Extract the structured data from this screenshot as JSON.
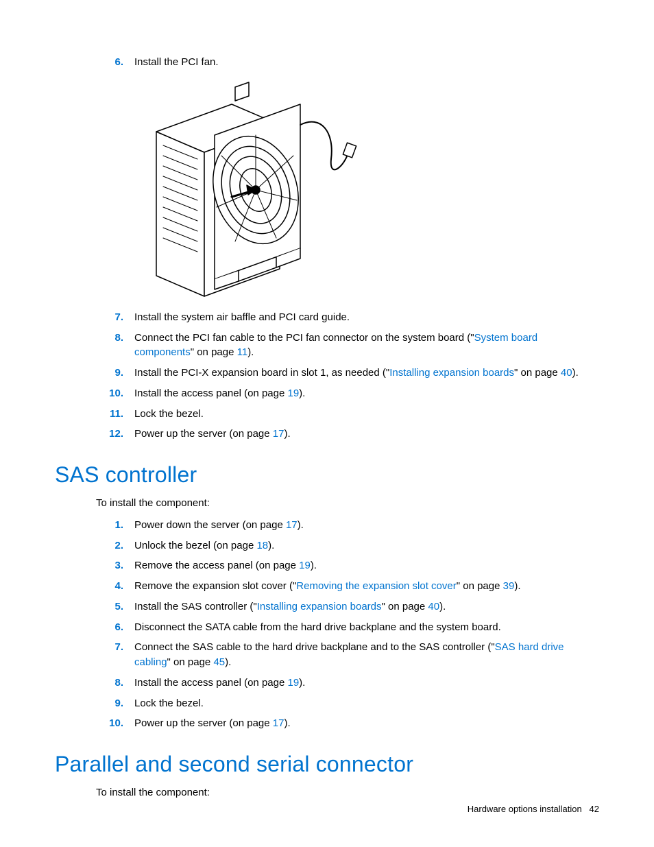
{
  "list1": [
    {
      "n": "6.",
      "segments": [
        {
          "t": "Install the PCI fan."
        }
      ]
    },
    {
      "n": "7.",
      "segments": [
        {
          "t": "Install the system air baffle and PCI card guide."
        }
      ]
    },
    {
      "n": "8.",
      "segments": [
        {
          "t": "Connect the PCI fan cable to the PCI fan connector on the system board (\""
        },
        {
          "t": "System board components",
          "link": true
        },
        {
          "t": "\" on page "
        },
        {
          "t": "11",
          "link": true
        },
        {
          "t": ")."
        }
      ]
    },
    {
      "n": "9.",
      "segments": [
        {
          "t": "Install the PCI-X expansion board in slot 1, as needed (\""
        },
        {
          "t": "Installing expansion boards",
          "link": true
        },
        {
          "t": "\" on page "
        },
        {
          "t": "40",
          "link": true
        },
        {
          "t": ")."
        }
      ]
    },
    {
      "n": "10.",
      "segments": [
        {
          "t": "Install the access panel (on page "
        },
        {
          "t": "19",
          "link": true
        },
        {
          "t": ")."
        }
      ]
    },
    {
      "n": "11.",
      "segments": [
        {
          "t": "Lock the bezel."
        }
      ]
    },
    {
      "n": "12.",
      "segments": [
        {
          "t": "Power up the server (on page "
        },
        {
          "t": "17",
          "link": true
        },
        {
          "t": ")."
        }
      ]
    }
  ],
  "heading1": "SAS controller",
  "intro1": "To install the component:",
  "list2": [
    {
      "n": "1.",
      "segments": [
        {
          "t": "Power down the server (on page "
        },
        {
          "t": "17",
          "link": true
        },
        {
          "t": ")."
        }
      ]
    },
    {
      "n": "2.",
      "segments": [
        {
          "t": "Unlock the bezel (on page "
        },
        {
          "t": "18",
          "link": true
        },
        {
          "t": ")."
        }
      ]
    },
    {
      "n": "3.",
      "segments": [
        {
          "t": "Remove the access panel (on page "
        },
        {
          "t": "19",
          "link": true
        },
        {
          "t": ")."
        }
      ]
    },
    {
      "n": "4.",
      "segments": [
        {
          "t": "Remove the expansion slot cover (\""
        },
        {
          "t": "Removing the expansion slot cover",
          "link": true
        },
        {
          "t": "\" on page "
        },
        {
          "t": "39",
          "link": true
        },
        {
          "t": ")."
        }
      ]
    },
    {
      "n": "5.",
      "segments": [
        {
          "t": "Install the SAS controller (\""
        },
        {
          "t": "Installing expansion boards",
          "link": true
        },
        {
          "t": "\" on page "
        },
        {
          "t": "40",
          "link": true
        },
        {
          "t": ")."
        }
      ]
    },
    {
      "n": "6.",
      "segments": [
        {
          "t": "Disconnect the SATA cable from the hard drive backplane and the system board."
        }
      ]
    },
    {
      "n": "7.",
      "segments": [
        {
          "t": "Connect the SAS cable to the hard drive backplane and to the SAS controller (\""
        },
        {
          "t": "SAS hard drive cabling",
          "link": true
        },
        {
          "t": "\" on page "
        },
        {
          "t": "45",
          "link": true
        },
        {
          "t": ")."
        }
      ]
    },
    {
      "n": "8.",
      "segments": [
        {
          "t": "Install the access panel (on page "
        },
        {
          "t": "19",
          "link": true
        },
        {
          "t": ")."
        }
      ]
    },
    {
      "n": "9.",
      "segments": [
        {
          "t": "Lock the bezel."
        }
      ]
    },
    {
      "n": "10.",
      "segments": [
        {
          "t": "Power up the server (on page "
        },
        {
          "t": "17",
          "link": true
        },
        {
          "t": ")."
        }
      ]
    }
  ],
  "heading2": "Parallel and second serial connector",
  "intro2": "To install the component:",
  "footer_text": "Hardware options installation",
  "footer_page": "42"
}
